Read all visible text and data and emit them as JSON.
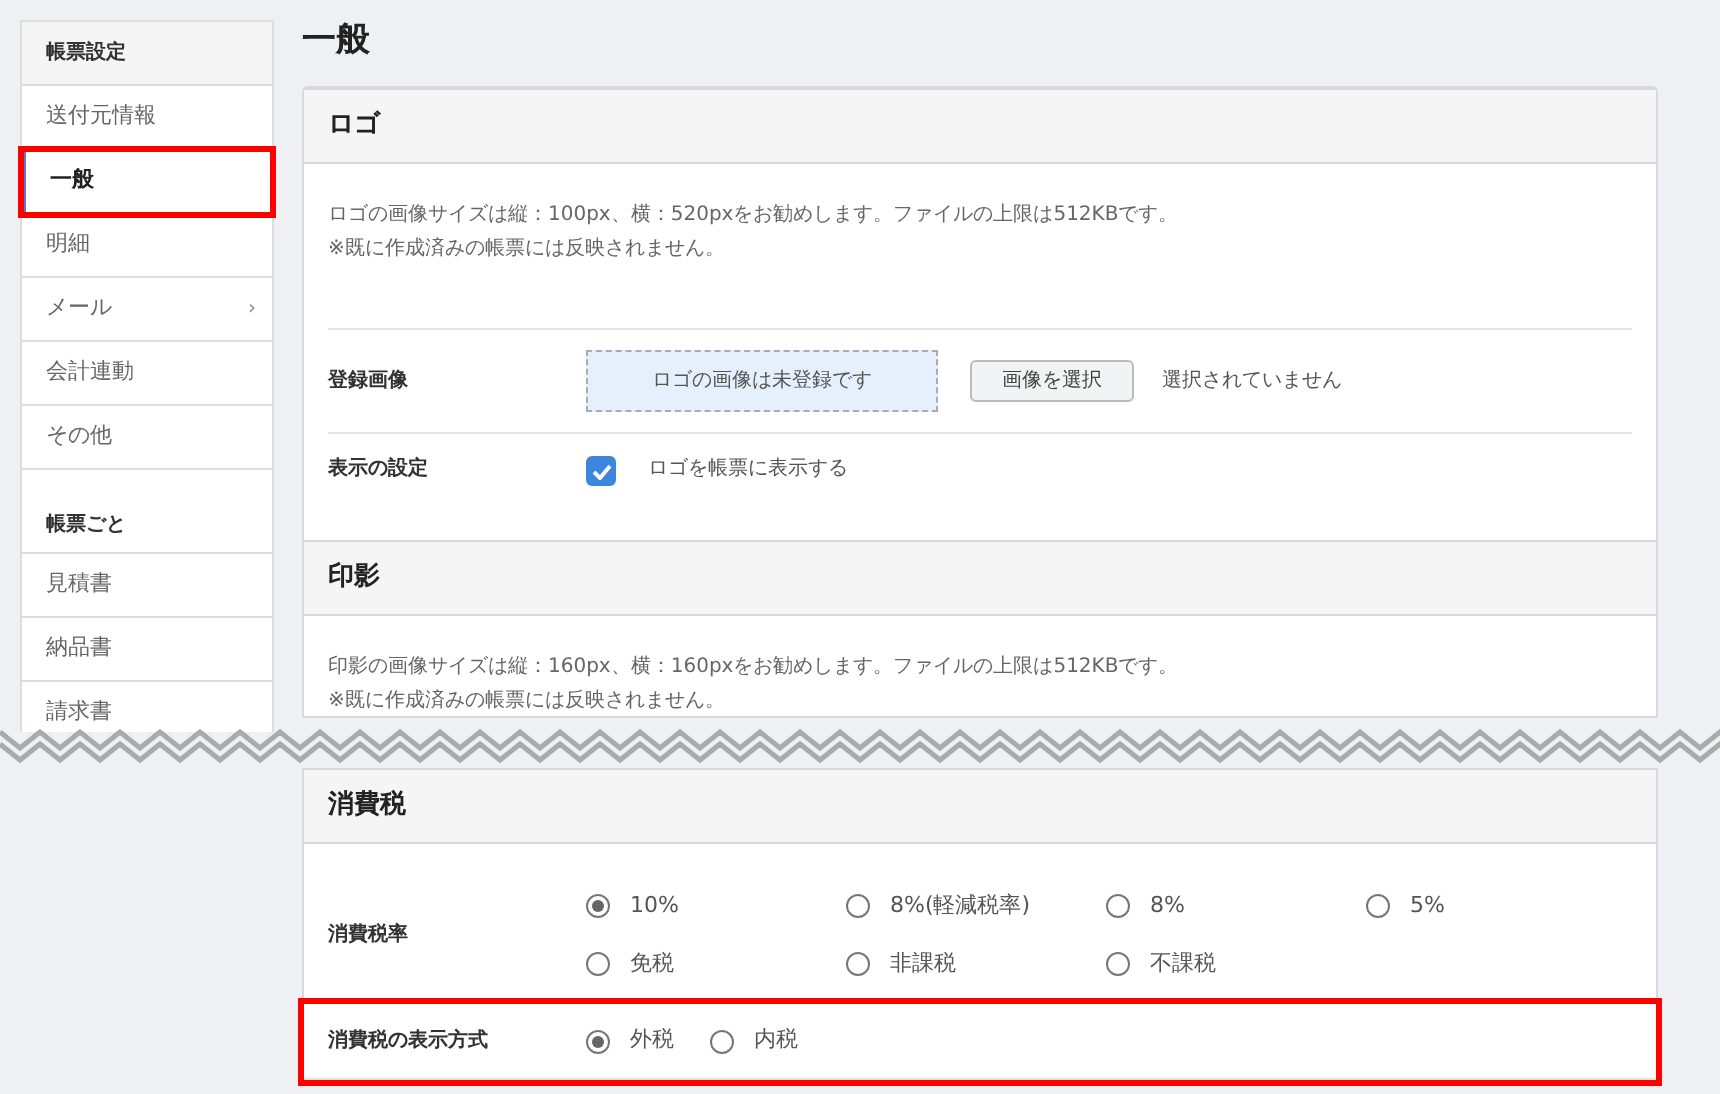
{
  "sidebar": {
    "groups": [
      {
        "title": "帳票設定",
        "items": [
          {
            "label": "送付元情報",
            "selected": false,
            "highlighted": false
          },
          {
            "label": "一般",
            "selected": true,
            "highlighted": true
          },
          {
            "label": "明細",
            "selected": false,
            "highlighted": false
          },
          {
            "label": "メール",
            "selected": false,
            "highlighted": false,
            "submenu_mark": "›"
          },
          {
            "label": "会計連動",
            "selected": false,
            "highlighted": false
          },
          {
            "label": "その他",
            "selected": false,
            "highlighted": false
          }
        ]
      },
      {
        "title": "帳票ごと",
        "items": [
          {
            "label": "見積書",
            "selected": false,
            "highlighted": false
          },
          {
            "label": "納品書",
            "selected": false,
            "highlighted": false
          },
          {
            "label": "請求書",
            "selected": false,
            "highlighted": false
          }
        ]
      }
    ]
  },
  "page_title": "一般",
  "logo_section": {
    "title": "ロゴ",
    "description": [
      "ロゴの画像サイズは縦：100px、横：520pxをお勧めします。ファイルの上限は512KBです。",
      "※既に作成済みの帳票には反映されません。"
    ],
    "image_row": {
      "label": "登録画像",
      "dropzone": "ロゴの画像は未登録です",
      "button": "画像を選択",
      "status": "選択されていません"
    },
    "display_row": {
      "label": "表示の設定",
      "checkbox": {
        "label": "ロゴを帳票に表示する",
        "checked": true
      }
    }
  },
  "seal_section": {
    "title": "印影",
    "description": [
      "印影の画像サイズは縦：160px、横：160pxをお勧めします。ファイルの上限は512KBです。",
      "※既に作成済みの帳票には反映されません。"
    ]
  },
  "tax_section": {
    "title": "消費税",
    "rows": [
      {
        "label": "消費税率",
        "highlighted": false,
        "options": [
          {
            "label": "10%",
            "selected": true
          },
          {
            "label": "8%(軽減税率)",
            "selected": false
          },
          {
            "label": "8%",
            "selected": false
          },
          {
            "label": "5%",
            "selected": false
          },
          {
            "label": "免税",
            "selected": false
          },
          {
            "label": "非課税",
            "selected": false
          },
          {
            "label": "不課税",
            "selected": false
          }
        ]
      },
      {
        "label": "消費税の表示方式",
        "highlighted": true,
        "options": [
          {
            "label": "外税",
            "selected": true
          },
          {
            "label": "内税",
            "selected": false
          }
        ]
      }
    ]
  }
}
